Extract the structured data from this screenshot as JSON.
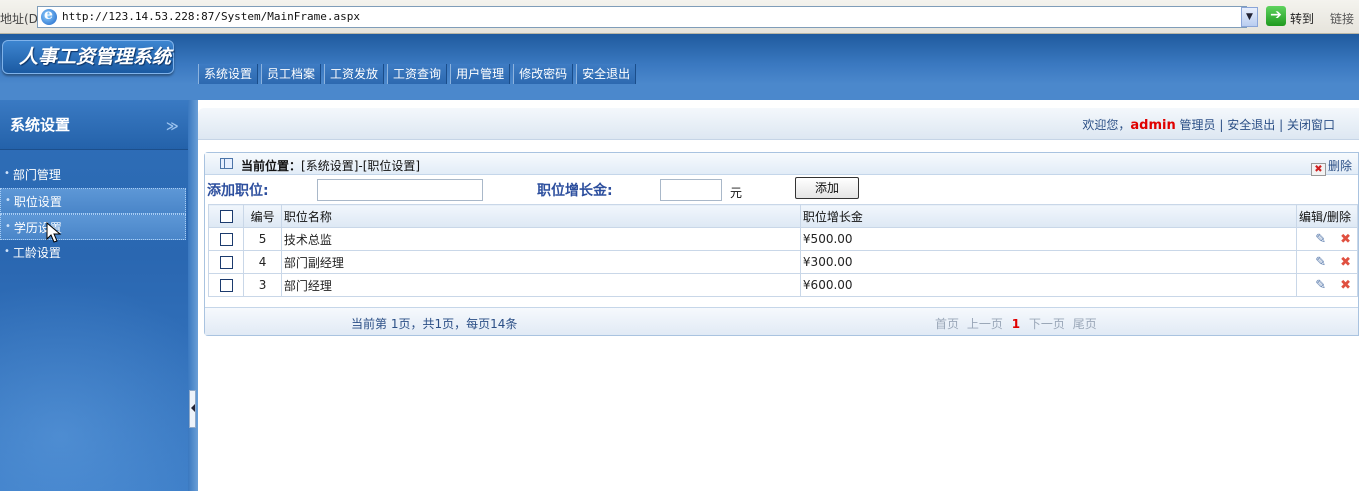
{
  "browser": {
    "address_label": "地址(D)",
    "url": "http://123.14.53.228:87/System/MainFrame.aspx",
    "go_label": "转到",
    "links_label": "链接"
  },
  "app": {
    "logo_text": "人事工资管理系统",
    "nav": [
      "系统设置",
      "员工档案",
      "工资发放",
      "工资查询",
      "用户管理",
      "修改密码",
      "安全退出"
    ]
  },
  "sidebar": {
    "title": "系统设置",
    "items": [
      {
        "label": "部门管理"
      },
      {
        "label": "职位设置"
      },
      {
        "label": "学历设置"
      },
      {
        "label": "工龄设置"
      }
    ]
  },
  "welcome": {
    "prefix": "欢迎您，",
    "user": "admin",
    "role": "管理员",
    "logout": "安全退出",
    "close": "关闭窗口",
    "sep": "|"
  },
  "panel": {
    "crumb_label": "当前位置：",
    "crumb_path": "[系统设置]-[职位设置]",
    "delete_label": "删除"
  },
  "form": {
    "position_label": "添加职位:",
    "position_value": "",
    "increase_label": "职位增长金:",
    "increase_value": "",
    "unit": "元",
    "add_button": "添加"
  },
  "table": {
    "headers": {
      "num": "编号",
      "name": "职位名称",
      "amount": "职位增长金",
      "ops": "编辑/删除"
    },
    "rows": [
      {
        "num": "5",
        "name": "技术总监",
        "amount": "¥500.00"
      },
      {
        "num": "4",
        "name": "部门副经理",
        "amount": "¥300.00"
      },
      {
        "num": "3",
        "name": "部门经理",
        "amount": "¥600.00"
      }
    ]
  },
  "pager": {
    "info": "当前第 1页，共1页，每页14条",
    "first": "首页",
    "prev": "上一页",
    "current": "1",
    "next": "下一页",
    "last": "尾页"
  }
}
